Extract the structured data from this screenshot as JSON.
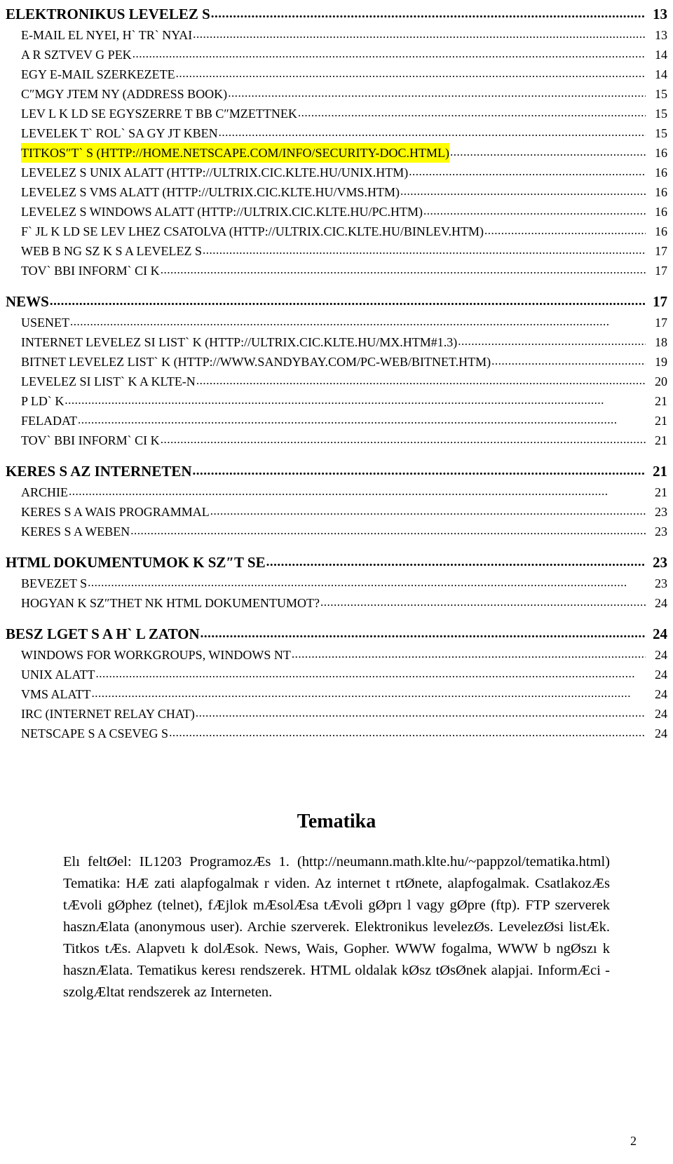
{
  "document": {
    "page_number": "2",
    "highlight_color": "#ffff00"
  },
  "toc": {
    "dot_leader": "..................................................................................................................................................................",
    "entries": [
      {
        "level": 1,
        "label": "ELEKTRONIKUS LEVELEZ S",
        "page": "13",
        "highlight": false,
        "gap_before": false
      },
      {
        "level": 2,
        "label": "E-MAIL EL NYEI, H` TR` NYAI",
        "page": "13",
        "highlight": false,
        "gap_before": false
      },
      {
        "level": 2,
        "label": "A R SZTVEV  G PEK",
        "page": "14",
        "highlight": false,
        "gap_before": false
      },
      {
        "level": 2,
        "label": "EGY E-MAIL SZERKEZETE",
        "page": "14",
        "highlight": false,
        "gap_before": false
      },
      {
        "level": 2,
        "label": "C″MGY JTEM NY (ADDRESS BOOK)",
        "page": "15",
        "highlight": false,
        "gap_before": false
      },
      {
        "level": 2,
        "label": "LEV L K LD SE EGYSZERRE T BB C″MZETTNEK",
        "page": "15",
        "highlight": false,
        "gap_before": false
      },
      {
        "level": 2,
        "label": "LEVELEK T` ROL` SA GY JT KBEN",
        "page": "15",
        "highlight": false,
        "gap_before": false
      },
      {
        "level": 2,
        "label": "TITKOS″T` S (HTTP://HOME.NETSCAPE.COM/INFO/SECURITY-DOC.HTML)",
        "page": "16",
        "highlight": true,
        "gap_before": false
      },
      {
        "level": 2,
        "label": "LEVELEZ S UNIX ALATT (HTTP://ULTRIX.CIC.KLTE.HU/UNIX.HTM)",
        "page": "16",
        "highlight": false,
        "gap_before": false
      },
      {
        "level": 2,
        "label": "LEVELEZ S VMS ALATT (HTTP://ULTRIX.CIC.KLTE.HU/VMS.HTM)",
        "page": "16",
        "highlight": false,
        "gap_before": false
      },
      {
        "level": 2,
        "label": "LEVELEZ S WINDOWS ALATT (HTTP://ULTRIX.CIC.KLTE.HU/PC.HTM)",
        "page": "16",
        "highlight": false,
        "gap_before": false
      },
      {
        "level": 2,
        "label": "F` JL K LD SE LEV LHEZ CSATOLVA (HTTP://ULTRIX.CIC.KLTE.HU/BINLEV.HTM)",
        "page": "16",
        "highlight": false,
        "gap_before": false
      },
      {
        "level": 2,
        "label": "WEB B NG SZ K  S A LEVELEZ S",
        "page": "17",
        "highlight": false,
        "gap_before": false
      },
      {
        "level": 2,
        "label": "TOV` BBI INFORM` CI K",
        "page": "17",
        "highlight": false,
        "gap_before": false
      },
      {
        "level": 1,
        "label": "NEWS",
        "page": "17",
        "highlight": false,
        "gap_before": true
      },
      {
        "level": 2,
        "label": "USENET",
        "page": "17",
        "highlight": false,
        "gap_before": false
      },
      {
        "level": 2,
        "label": "INTERNET LEVELEZ SI LIST` K (HTTP://ULTRIX.CIC.KLTE.HU/MX.HTM#1.3)",
        "page": "18",
        "highlight": false,
        "gap_before": false
      },
      {
        "level": 2,
        "label": "BITNET LEVELEZ  LIST` K (HTTP://WWW.SANDYBAY.COM/PC-WEB/BITNET.HTM)",
        "page": "19",
        "highlight": false,
        "gap_before": false
      },
      {
        "level": 2,
        "label": "LEVELEZ SI LIST` K A KLTE-N",
        "page": "20",
        "highlight": false,
        "gap_before": false
      },
      {
        "level": 2,
        "label": "P LD` K",
        "page": "21",
        "highlight": false,
        "gap_before": false
      },
      {
        "level": 2,
        "label": "FELADAT",
        "page": "21",
        "highlight": false,
        "gap_before": false
      },
      {
        "level": 2,
        "label": "TOV` BBI INFORM` CI K",
        "page": "21",
        "highlight": false,
        "gap_before": false
      },
      {
        "level": 1,
        "label": "KERES S AZ INTERNETEN",
        "page": "21",
        "highlight": false,
        "gap_before": true
      },
      {
        "level": 2,
        "label": "ARCHIE",
        "page": "21",
        "highlight": false,
        "gap_before": false
      },
      {
        "level": 2,
        "label": "KERES S A WAIS PROGRAMMAL",
        "page": "23",
        "highlight": false,
        "gap_before": false
      },
      {
        "level": 2,
        "label": "KERES S A WEBEN",
        "page": "23",
        "highlight": false,
        "gap_before": false
      },
      {
        "level": 1,
        "label": "HTML DOKUMENTUMOK K SZ″T SE",
        "page": "23",
        "highlight": false,
        "gap_before": true
      },
      {
        "level": 2,
        "label": "BEVEZET S",
        "page": "23",
        "highlight": false,
        "gap_before": false
      },
      {
        "level": 2,
        "label": "HOGYAN K SZ″THET NK HTML DOKUMENTUMOT?",
        "page": "24",
        "highlight": false,
        "gap_before": false
      },
      {
        "level": 1,
        "label": "BESZ LGET S A H` L ZATON",
        "page": "24",
        "highlight": false,
        "gap_before": true
      },
      {
        "level": 2,
        "label": "WINDOWS FOR WORKGROUPS, WINDOWS NT",
        "page": "24",
        "highlight": false,
        "gap_before": false
      },
      {
        "level": 2,
        "label": "UNIX ALATT",
        "page": "24",
        "highlight": false,
        "gap_before": false
      },
      {
        "level": 2,
        "label": "VMS ALATT",
        "page": "24",
        "highlight": false,
        "gap_before": false
      },
      {
        "level": 2,
        "label": "IRC (INTERNET RELAY CHAT)",
        "page": "24",
        "highlight": false,
        "gap_before": false
      },
      {
        "level": 2,
        "label": "NETSCAPE  S A CSEVEG S",
        "page": "24",
        "highlight": false,
        "gap_before": false
      }
    ]
  },
  "tematika": {
    "title": "Tematika",
    "body": "Elı feltØel: IL1203 ProgramozÆs 1. (http://neumann.math.klte.hu/~pappzol/tematika.html) Tematika: HÆ zati alapfogalmak r viden. Az internet t rtØnete, alapfogalmak. CsatlakozÆs tÆvoli gØphez (telnet), fÆjlok mÆsolÆsa tÆvoli gØprı l vagy gØpre (ftp). FTP szerverek hasznÆlata (anonymous user). Archie szerverek. Elektronikus levelezØs. LevelezØsi listÆk. Titkos tÆs. Alapvetı k dolÆsok. News, Wais, Gopher. WWW fogalma, WWW b ngØszı k hasznÆlata. Tematikus keresı rendszerek. HTML oldalak kØsz tØsØnek alapjai. InformÆci - szolgÆltat  rendszerek az Interneten."
  }
}
